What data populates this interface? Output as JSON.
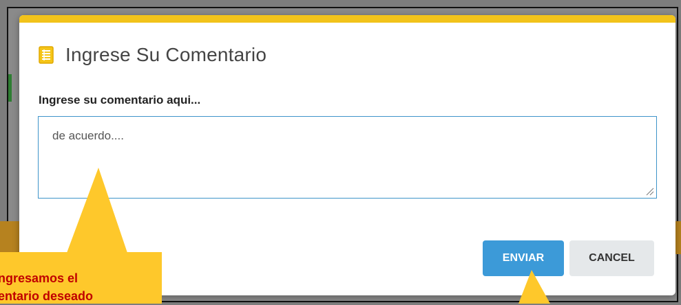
{
  "modal": {
    "title": "Ingrese Su Comentario",
    "title_icon": "list-icon",
    "field_label": "Ingrese su comentario aqui...",
    "comment_value": "de acuerdo....",
    "send_label": "ENVIAR",
    "cancel_label": "CANCEL"
  },
  "callout": {
    "line1": "ngresamos el",
    "line2": "entario deseado"
  },
  "colors": {
    "accent_bar": "#f2c31b",
    "send_button": "#3c9ad8",
    "callout_fill": "#fec82b",
    "callout_text": "#c00000"
  }
}
